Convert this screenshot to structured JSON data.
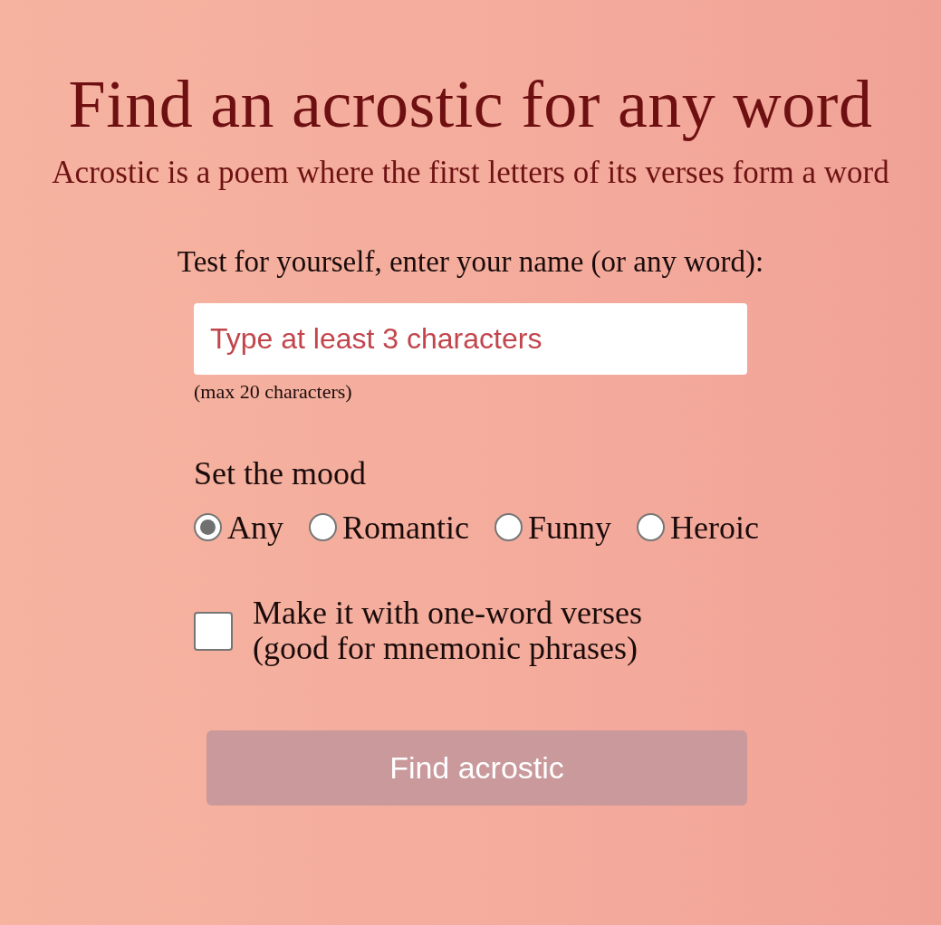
{
  "title": "Find an acrostic for any word",
  "subtitle": "Acrostic is a poem where the first letters of its verses form a word",
  "prompt": "Test for yourself, enter your name (or any word):",
  "word_field": {
    "placeholder": "Type at least 3 characters"
  },
  "hint": "(max 20 characters)",
  "mood": {
    "label": "Set the mood",
    "options": [
      {
        "label": "Any",
        "selected": true
      },
      {
        "label": "Romantic",
        "selected": false
      },
      {
        "label": "Funny",
        "selected": false
      },
      {
        "label": "Heroic",
        "selected": false
      }
    ]
  },
  "one_word": {
    "label": "Make it with one-word verses\n(good for mnemonic phrases)",
    "checked": false
  },
  "button": {
    "label": "Find acrostic",
    "disabled": true
  }
}
